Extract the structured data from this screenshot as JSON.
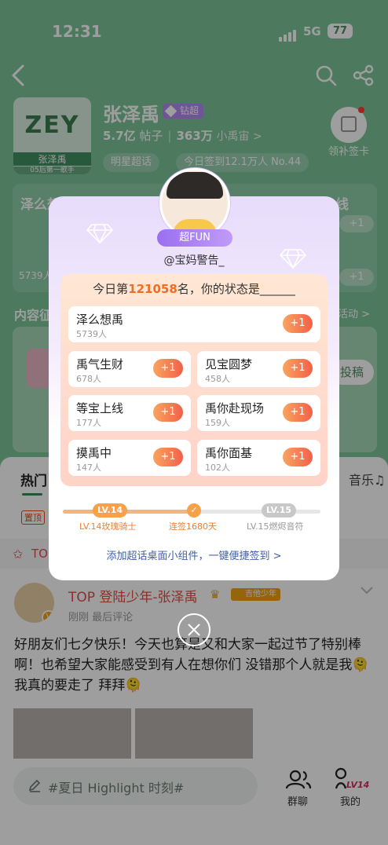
{
  "status_bar": {
    "time": "12:31",
    "network": "5G",
    "battery": "77"
  },
  "header": {
    "name": "张泽禹",
    "level_badge": "钻超",
    "posts_count": "5.7亿",
    "posts_label": "帖子",
    "fans_count": "363万",
    "fans_label": "小禹宙 >",
    "avatar_text": "ZEY",
    "avatar_caption": "张泽禹",
    "avatar_caption2": "05后第一歌手",
    "chip_1": "明星超话",
    "chip_2": "今日签到12.1万人 No.44",
    "makeup_label": "领补签卡"
  },
  "bg_card": {
    "left_title": "泽么想禹",
    "right_title": "等宝上线",
    "count": "5739人",
    "plus": "+1"
  },
  "content_section": {
    "title": "内容征",
    "right": "活动 >",
    "button": "投稿"
  },
  "feed": {
    "tab_hot": "热门",
    "tab_music": "音乐♫",
    "pin": "置顶",
    "top_label": "TOP",
    "author": "TOP 登陆少年-张泽禹",
    "fan_badge": "吉他少年",
    "time": "刚刚  最后评论",
    "text": "好朋友们七夕快乐！今天也算是又和大家一起过节了特别棒啊！也希望大家能感受到有人在想你们 没错那个人就是我🫠 我真的要走了 拜拜🫠"
  },
  "bottom_bar": {
    "compose_placeholder": "#夏日 Highlight 时刻#",
    "group_chat": "群聊",
    "me": "我的",
    "me_badge": "LV14"
  },
  "popup": {
    "badge": "超FUN",
    "username": "@宝妈警告_",
    "title_prefix": "今日第",
    "rank": "121058",
    "title_suffix": "名，你的状态是______",
    "options": [
      {
        "label": "泽么想禹",
        "count": "5739人",
        "plus": "+1"
      },
      {
        "label": "禹气生财",
        "count": "678人",
        "plus": "+1"
      },
      {
        "label": "见宝圆梦",
        "count": "458人",
        "plus": "+1"
      },
      {
        "label": "等宝上线",
        "count": "177人",
        "plus": "+1"
      },
      {
        "label": "禹你赴现场",
        "count": "159人",
        "plus": "+1"
      },
      {
        "label": "摸禹中",
        "count": "147人",
        "plus": "+1"
      },
      {
        "label": "禹你面基",
        "count": "102人",
        "plus": "+1"
      }
    ],
    "progress": {
      "current_level": "LV.14",
      "current_title": "LV.14玫瑰骑士",
      "streak": "连签1680天",
      "next_level": "LV.15",
      "next_title": "LV.15燃烬音符"
    },
    "widget_link": "添加超话桌面小组件，一键便捷签到 >"
  },
  "colors": {
    "accent_green": "#7cc69a",
    "orange": "#f36c21",
    "purple": "#9b6ff0"
  }
}
